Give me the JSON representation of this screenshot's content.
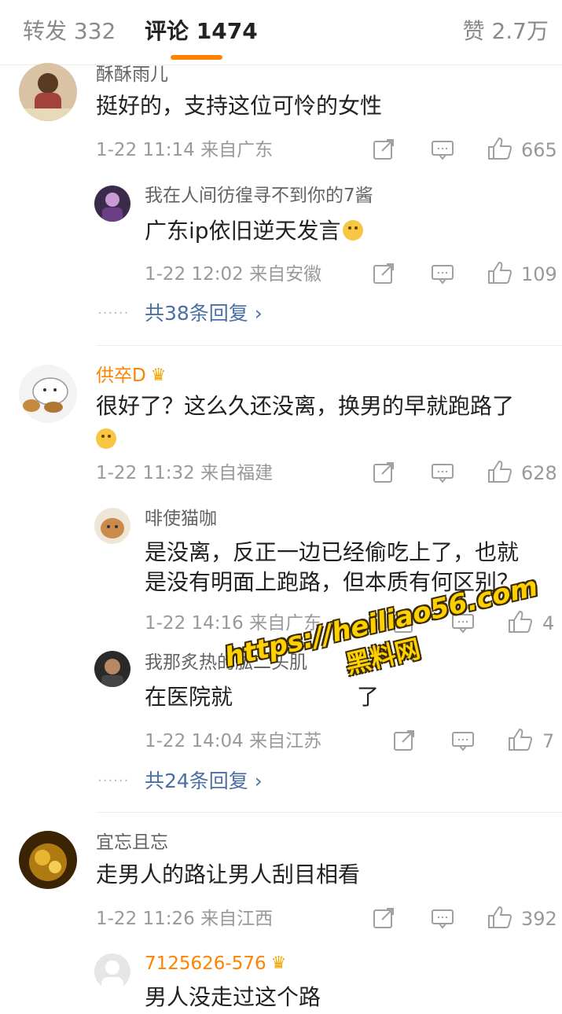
{
  "tabs": {
    "repost": "转发 332",
    "comments": "评论 1474",
    "likes": "赞 2.7万"
  },
  "comments": [
    {
      "user": "酥酥雨儿",
      "text": "挺好的，支持这位可怜的女性",
      "time": "1-22 11:14",
      "location": "来自广东",
      "likes": "665",
      "replies": [
        {
          "user": "我在人间彷徨寻不到你的7酱",
          "text": "广东ip依旧逆天发言",
          "time": "1-22 12:02",
          "location": "来自安徽",
          "likes": "109"
        }
      ],
      "more_replies": "共38条回复 ›"
    },
    {
      "user": "供卒D",
      "text_line1": "很好了？这么久还没离，换男的早就跑路了",
      "time": "1-22 11:32",
      "location": "来自福建",
      "likes": "628",
      "replies": [
        {
          "user": "啡使猫咖",
          "text_line1": "是没离，反正一边已经偷吃上了，也就",
          "text_line2": "是没有明面上跑路，但本质有何区别？",
          "time": "1-22 14:16",
          "location": "来自广东",
          "likes": "4"
        },
        {
          "user": "我那炙热的肱二头肌",
          "text": "在医院就",
          "text_tail": "了",
          "time": "1-22 14:04",
          "location": "来自江苏",
          "likes": "7"
        }
      ],
      "more_replies": "共24条回复 ›"
    },
    {
      "user": "宜忘且忘",
      "text": "走男人的路让男人刮目相看",
      "time": "1-22 11:26",
      "location": "来自江西",
      "likes": "392",
      "replies": [
        {
          "user": "7125626-576",
          "text": "男人没走过这个路"
        }
      ]
    }
  ],
  "watermark": {
    "url": "https://heiliao56.com",
    "name": "黑料网"
  },
  "icons": [
    "share-icon",
    "comment-icon",
    "like-icon",
    "crown-badge-icon",
    "smile-emoji-icon"
  ],
  "colors": {
    "accent": "#ff8200",
    "link": "#4a6fa5",
    "meta": "#999999"
  }
}
